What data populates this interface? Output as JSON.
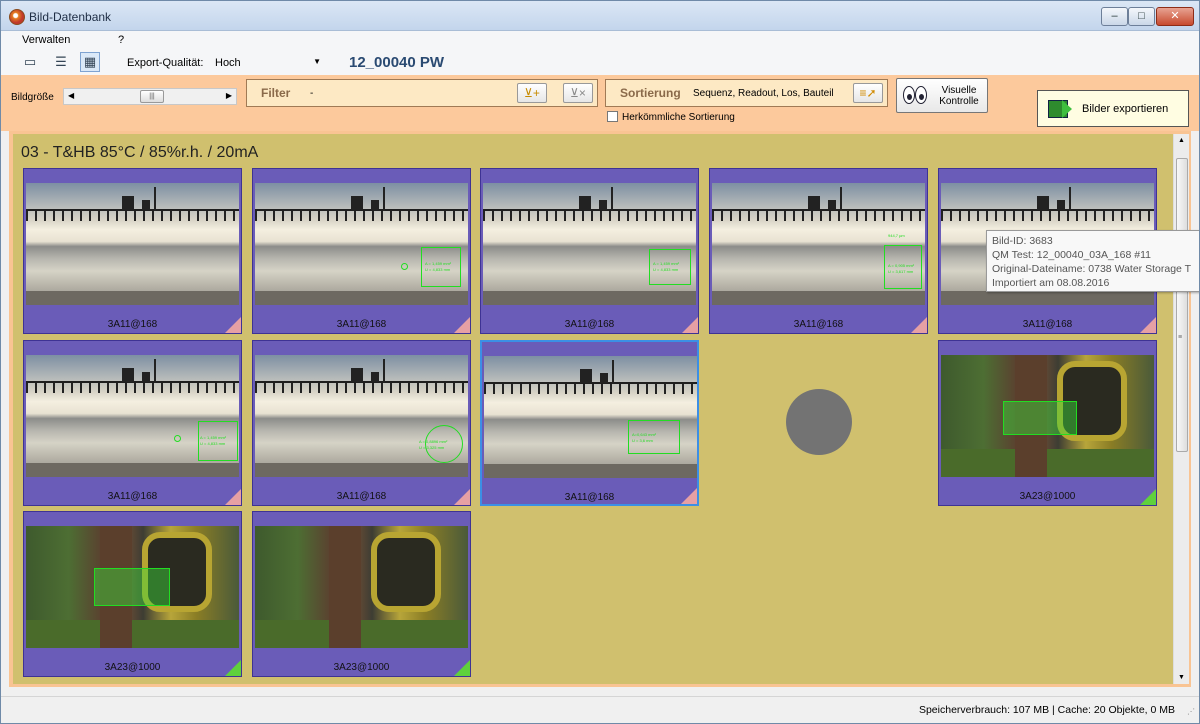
{
  "window": {
    "title": "Bild-Datenbank",
    "minimize": "–",
    "maximize": "□",
    "close": "✕"
  },
  "menu": {
    "items": [
      "Verwalten",
      "?"
    ]
  },
  "toolbar": {
    "export_quality_label": "Export-Qualität:",
    "export_quality_value": "Hoch",
    "project": "12_00040 PW"
  },
  "controls": {
    "image_size_label": "Bildgröße",
    "filter_label": "Filter",
    "filter_value": "-",
    "sort_label": "Sortierung",
    "sort_value": "Sequenz, Readout, Los, Bauteil",
    "conventional_sort": "Herkömmliche Sortierung",
    "visual_check": "Visuelle Kontrolle",
    "export_images": "Bilder exportieren"
  },
  "gallery": {
    "group_title": "03 - T&HB 85°C / 85%r.h. / 20mA",
    "tiles": [
      {
        "caption": "3A11@168",
        "image": "water",
        "overlay": "none",
        "status": "red"
      },
      {
        "caption": "3A11@168",
        "image": "water",
        "overlay": "measure-a",
        "status": "red"
      },
      {
        "caption": "3A11@168",
        "image": "water",
        "overlay": "measure-b",
        "status": "red"
      },
      {
        "caption": "3A11@168",
        "image": "water",
        "overlay": "measure-c",
        "status": "red"
      },
      {
        "caption": "3A11@168",
        "image": "water",
        "overlay": "none",
        "status": "red"
      },
      {
        "caption": "3A11@168",
        "image": "water",
        "overlay": "measure-a",
        "status": "red"
      },
      {
        "caption": "3A11@168",
        "image": "water",
        "overlay": "measure-d",
        "status": "red"
      },
      {
        "caption": "3A11@168",
        "image": "water",
        "overlay": "measure-e",
        "status": "red",
        "selected": true
      },
      {
        "caption": "3A23@1000",
        "image": "forest",
        "overlay": "region",
        "status": "green"
      },
      {
        "caption": "3A23@1000",
        "image": "forest",
        "overlay": "region",
        "status": "green"
      },
      {
        "caption": "3A23@1000",
        "image": "forest",
        "overlay": "none",
        "status": "green"
      }
    ]
  },
  "tooltip": {
    "lines": [
      "Bild-ID: 3683",
      "QM Test: 12_00040_03A_168 #11",
      "Original-Dateiname: 0738 Water Storage T",
      "Importiert am 08.08.2016"
    ]
  },
  "overlay_text": {
    "measure_a": "A = 1,459 mm²",
    "measure_a2": "U = 4,833 mm",
    "measure_c": "944,7 µm",
    "measure_c2": "A = 0,905 mm²",
    "measure_c3": "U = 3,617 mm",
    "measure_d": "A = 0,8896 mm²",
    "measure_d2": "U = 3,325 mm",
    "measure_e": "A=0,643 mm²",
    "measure_e2": "U = 3,6 mm"
  },
  "status": {
    "text": "Speicherverbrauch: 107 MB  | Cache: 20 Objekte, 0 MB"
  },
  "colors": {
    "panel_bg": "#fcc99c",
    "gallery_bg": "#d0c06e",
    "tile_bg": "#6a5cb8",
    "status_red": "#e6a0a4",
    "status_green": "#5fd13c",
    "selection": "#3c8fe5"
  }
}
